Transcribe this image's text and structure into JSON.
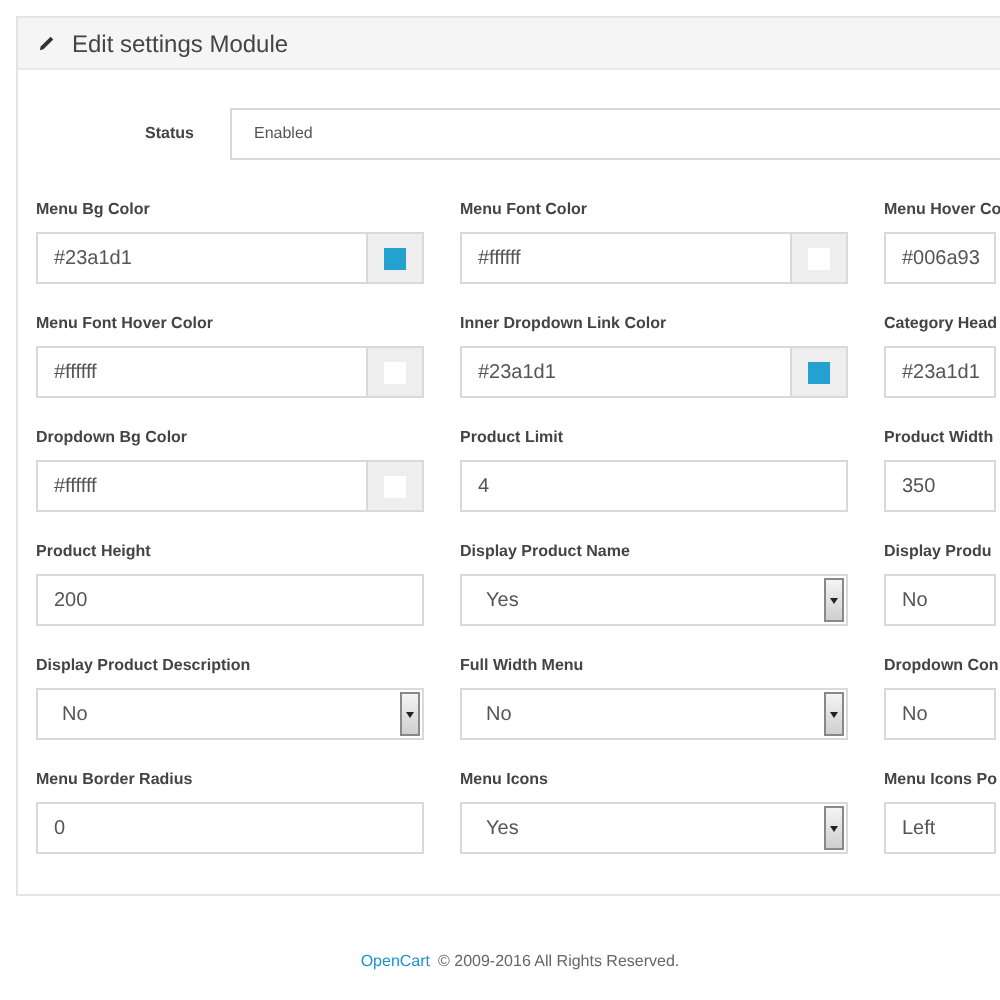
{
  "panel": {
    "title": "Edit settings Module"
  },
  "status": {
    "label": "Status",
    "value": "Enabled"
  },
  "fields": [
    {
      "label": "Menu Bg Color",
      "value": "#23a1d1",
      "kind": "color",
      "color": "#23a1d1"
    },
    {
      "label": "Menu Font Color",
      "value": "#ffffff",
      "kind": "color",
      "color": "#ffffff"
    },
    {
      "label": "Menu Hover Co",
      "value": "#006a93",
      "kind": "text"
    },
    {
      "label": "Menu Font Hover Color",
      "value": "#ffffff",
      "kind": "color",
      "color": "#ffffff"
    },
    {
      "label": "Inner Dropdown Link Color",
      "value": "#23a1d1",
      "kind": "color",
      "color": "#23a1d1"
    },
    {
      "label": "Category Head",
      "value": "#23a1d1",
      "kind": "text"
    },
    {
      "label": "Dropdown Bg Color",
      "value": "#ffffff",
      "kind": "color",
      "color": "#ffffff"
    },
    {
      "label": "Product Limit",
      "value": "4",
      "kind": "text"
    },
    {
      "label": "Product Width",
      "value": "350",
      "kind": "text"
    },
    {
      "label": "Product Height",
      "value": "200",
      "kind": "text"
    },
    {
      "label": "Display Product Name",
      "value": "Yes",
      "kind": "select"
    },
    {
      "label": "Display Produ",
      "value": "No",
      "kind": "text"
    },
    {
      "label": "Display Product Description",
      "value": "No",
      "kind": "select"
    },
    {
      "label": "Full Width Menu",
      "value": "No",
      "kind": "select"
    },
    {
      "label": "Dropdown Con",
      "value": "No",
      "kind": "text"
    },
    {
      "label": "Menu Border Radius",
      "value": "0",
      "kind": "text"
    },
    {
      "label": "Menu Icons",
      "value": "Yes",
      "kind": "select"
    },
    {
      "label": "Menu Icons Po",
      "value": "Left",
      "kind": "text"
    }
  ],
  "footer": {
    "link": "OpenCart",
    "text": "© 2009-2016 All Rights Reserved."
  }
}
